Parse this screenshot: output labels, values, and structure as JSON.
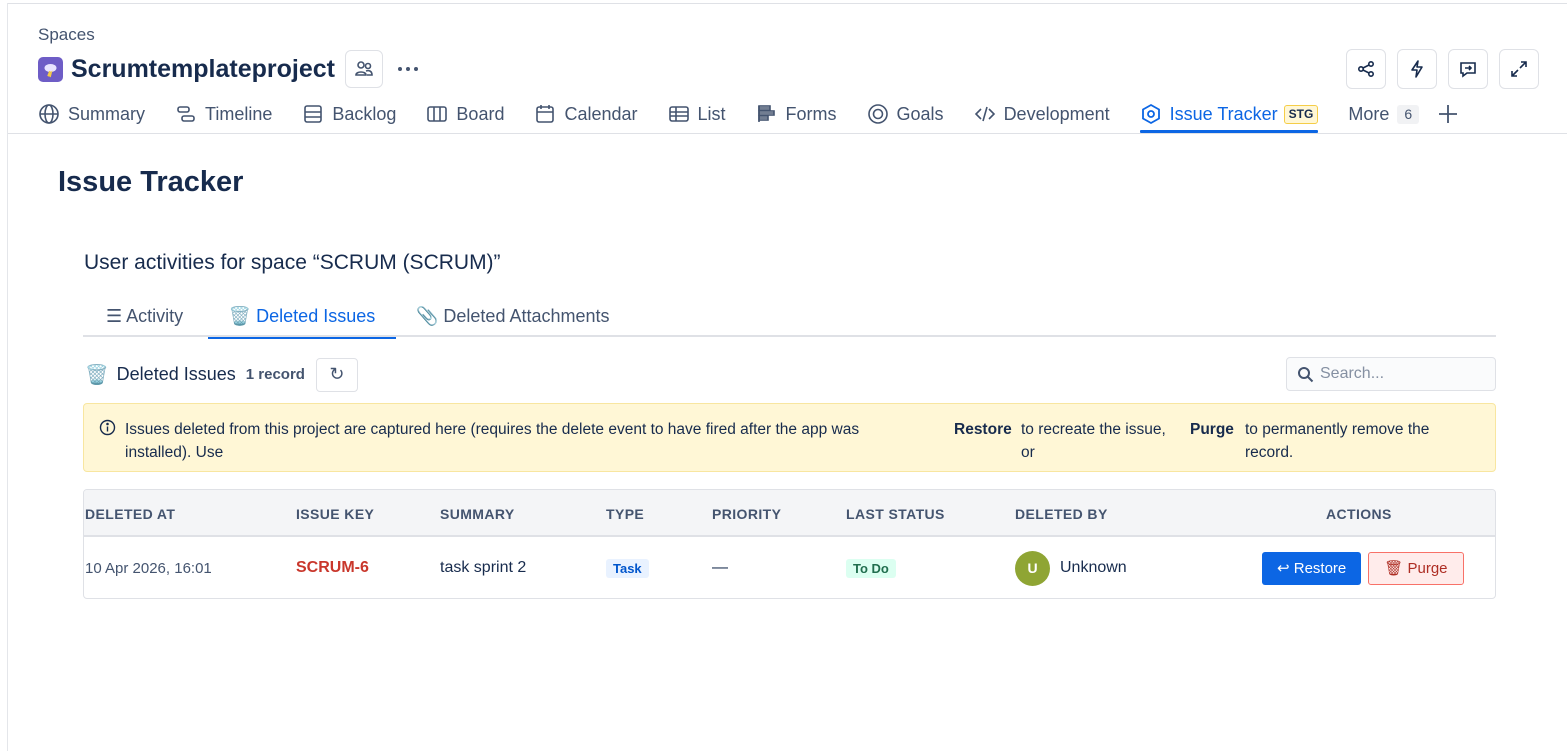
{
  "breadcrumb": "Spaces",
  "project": {
    "title": "Scrumtemplateproject"
  },
  "nav": {
    "items": [
      {
        "label": "Summary",
        "icon": "globe-icon"
      },
      {
        "label": "Timeline",
        "icon": "timeline-icon"
      },
      {
        "label": "Backlog",
        "icon": "backlog-icon"
      },
      {
        "label": "Board",
        "icon": "board-icon"
      },
      {
        "label": "Calendar",
        "icon": "calendar-icon"
      },
      {
        "label": "List",
        "icon": "list-icon"
      },
      {
        "label": "Forms",
        "icon": "forms-icon"
      },
      {
        "label": "Goals",
        "icon": "goals-icon"
      },
      {
        "label": "Development",
        "icon": "code-icon"
      },
      {
        "label": "Issue Tracker",
        "icon": "app-icon",
        "badge": "STG",
        "active": true
      },
      {
        "label": "More",
        "count": "6"
      }
    ]
  },
  "page": {
    "title": "Issue Tracker",
    "subtitle": "User activities for space “SCRUM (SCRUM)”"
  },
  "tabs": [
    {
      "label": "☰ Activity"
    },
    {
      "label": "🗑️ Deleted Issues",
      "active": true
    },
    {
      "label": "📎 Deleted Attachments"
    }
  ],
  "section": {
    "icon": "🗑️",
    "title": "Deleted Issues",
    "count": "1 record",
    "refresh": "↻"
  },
  "search": {
    "placeholder": "Search..."
  },
  "notice": {
    "text1": "Issues deleted from this project are captured here (requires the delete event to have fired after the app was installed). Use",
    "restore_word": "Restore",
    "text2": "to recreate the issue, or",
    "purge_word": "Purge",
    "text3": "to permanently remove the record."
  },
  "table": {
    "headers": [
      "DELETED AT",
      "ISSUE KEY",
      "SUMMARY",
      "TYPE",
      "PRIORITY",
      "LAST STATUS",
      "DELETED BY",
      "ACTIONS"
    ],
    "rows": [
      {
        "deleted_at": "10 Apr 2026, 16:01",
        "issue_key": "SCRUM-6",
        "summary": "task sprint 2",
        "type": "Task",
        "priority": "—",
        "last_status": "To Do",
        "avatar": "U",
        "deleted_by": "Unknown",
        "restore_label": "↩ Restore",
        "purge_label": "🗑 Purge"
      }
    ]
  },
  "colors": {
    "accent": "#0c66e4",
    "issue_key": "#c9372c",
    "avatar": "#8fa534",
    "notice_bg": "#fff7d6"
  }
}
